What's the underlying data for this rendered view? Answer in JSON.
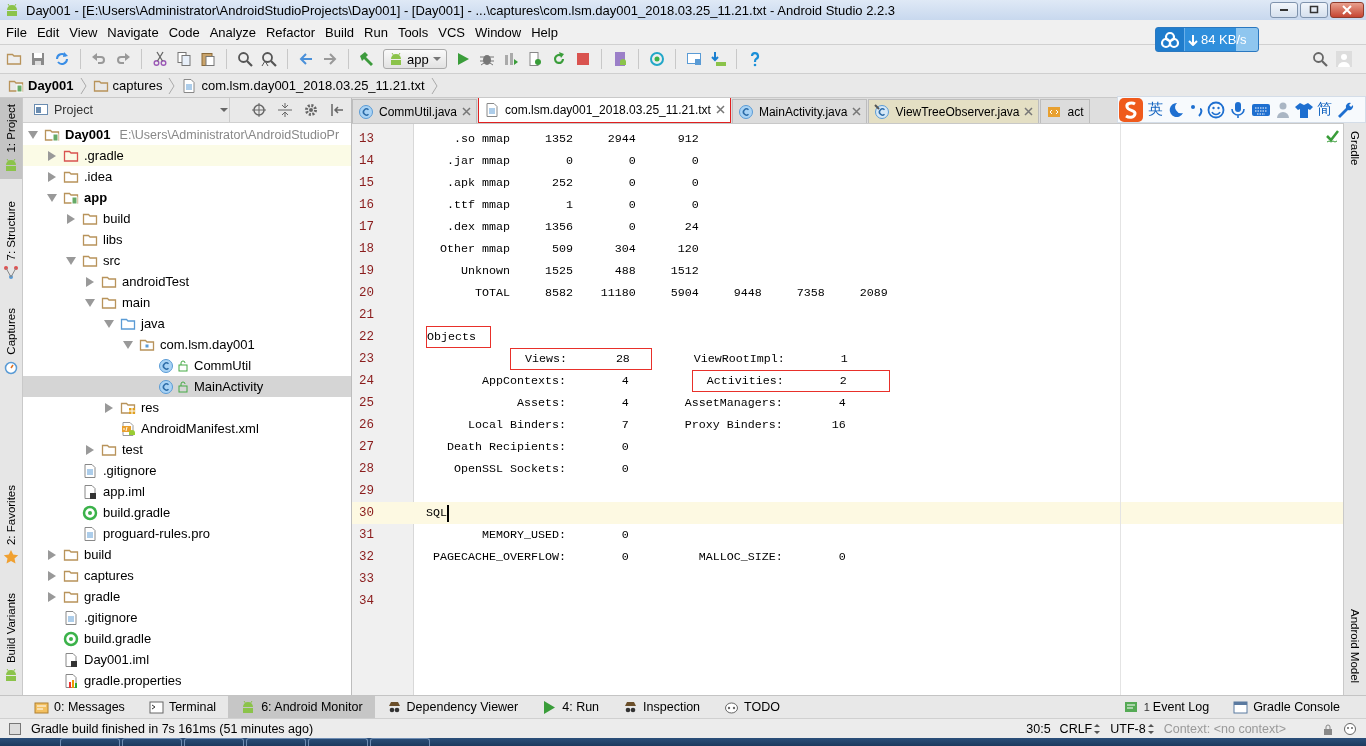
{
  "window": {
    "title": "Day001 - [E:\\Users\\Administrator\\AndroidStudioProjects\\Day001] - [Day001] - ...\\captures\\com.lsm.day001_2018.03.25_11.21.txt - Android Studio 2.2.3"
  },
  "menu": [
    "File",
    "Edit",
    "View",
    "Navigate",
    "Code",
    "Analyze",
    "Refactor",
    "Build",
    "Run",
    "Tools",
    "VCS",
    "Window",
    "Help"
  ],
  "toolbar": {
    "run_configuration": "app"
  },
  "breadcrumbs": [
    {
      "label": "Day001",
      "kind": "module"
    },
    {
      "label": "captures",
      "kind": "folder"
    },
    {
      "label": "com.lsm.day001_2018.03.25_11.21.txt",
      "kind": "text"
    }
  ],
  "left_strip": {
    "top": [
      {
        "label": "1: Project",
        "kind": "android",
        "selected": true
      },
      {
        "label": "7: Structure",
        "kind": "structure",
        "selected": false
      },
      {
        "label": "Captures",
        "kind": "camera",
        "selected": false
      }
    ],
    "bottom": [
      {
        "label": "2: Favorites",
        "kind": "star",
        "selected": false
      },
      {
        "label": "Build Variants",
        "kind": "android",
        "selected": false
      }
    ]
  },
  "right_strip": {
    "top": [
      {
        "label": "Gradle",
        "selected": false
      }
    ],
    "bottom": [
      {
        "label": "Android Model",
        "selected": false
      }
    ]
  },
  "project": {
    "view": "Project",
    "tree": [
      {
        "label": "Day001",
        "path": "E:\\Users\\Administrator\\AndroidStudioPr",
        "kind": "module",
        "expanded": true,
        "selected": false,
        "highlighted": false,
        "children": [
          {
            "label": ".gradle",
            "kind": "excluded-folder",
            "expanded": false,
            "selected": false,
            "highlighted": true
          },
          {
            "label": ".idea",
            "kind": "folder",
            "expanded": false,
            "selected": false,
            "highlighted": false
          },
          {
            "label": "app",
            "kind": "module",
            "expanded": true,
            "selected": false,
            "highlighted": false,
            "children": [
              {
                "label": "build",
                "kind": "folder",
                "expanded": false,
                "selected": false,
                "highlighted": false
              },
              {
                "label": "libs",
                "kind": "folder",
                "selected": false,
                "highlighted": false
              },
              {
                "label": "src",
                "kind": "folder",
                "expanded": true,
                "selected": false,
                "highlighted": false,
                "children": [
                  {
                    "label": "androidTest",
                    "kind": "folder",
                    "expanded": false,
                    "selected": false,
                    "highlighted": false
                  },
                  {
                    "label": "main",
                    "kind": "folder",
                    "expanded": true,
                    "selected": false,
                    "highlighted": false,
                    "children": [
                      {
                        "label": "java",
                        "kind": "source-folder",
                        "expanded": true,
                        "selected": false,
                        "highlighted": false,
                        "children": [
                          {
                            "label": "com.lsm.day001",
                            "kind": "package",
                            "expanded": true,
                            "selected": false,
                            "highlighted": false,
                            "children": [
                              {
                                "label": "CommUtil",
                                "kind": "class",
                                "selected": false,
                                "highlighted": false
                              },
                              {
                                "label": "MainActivity",
                                "kind": "class",
                                "selected": true,
                                "highlighted": false
                              }
                            ]
                          }
                        ]
                      },
                      {
                        "label": "res",
                        "kind": "resource-folder",
                        "expanded": false,
                        "selected": false,
                        "highlighted": false
                      },
                      {
                        "label": "AndroidManifest.xml",
                        "kind": "manifest",
                        "selected": false,
                        "highlighted": false
                      }
                    ]
                  },
                  {
                    "label": "test",
                    "kind": "folder",
                    "expanded": false,
                    "selected": false,
                    "highlighted": false
                  }
                ]
              },
              {
                "label": ".gitignore",
                "kind": "text",
                "selected": false,
                "highlighted": false
              },
              {
                "label": "app.iml",
                "kind": "iml",
                "selected": false,
                "highlighted": false
              },
              {
                "label": "build.gradle",
                "kind": "gradle",
                "selected": false,
                "highlighted": false
              },
              {
                "label": "proguard-rules.pro",
                "kind": "text",
                "selected": false,
                "highlighted": false
              }
            ]
          },
          {
            "label": "build",
            "kind": "folder",
            "expanded": false,
            "selected": false,
            "highlighted": false
          },
          {
            "label": "captures",
            "kind": "folder",
            "expanded": false,
            "selected": false,
            "highlighted": false
          },
          {
            "label": "gradle",
            "kind": "folder",
            "expanded": false,
            "selected": false,
            "highlighted": false
          },
          {
            "label": ".gitignore",
            "kind": "text",
            "selected": false,
            "highlighted": false
          },
          {
            "label": "build.gradle",
            "kind": "gradle",
            "selected": false,
            "highlighted": false
          },
          {
            "label": "Day001.iml",
            "kind": "iml",
            "selected": false,
            "highlighted": false
          },
          {
            "label": "gradle.properties",
            "kind": "properties",
            "selected": false,
            "highlighted": false
          }
        ]
      }
    ]
  },
  "editor": {
    "tabs": [
      {
        "label": "CommUtil.java",
        "kind": "class",
        "selected": false,
        "outlined": false
      },
      {
        "label": "com.lsm.day001_2018.03.25_11.21.txt",
        "kind": "text",
        "selected": true,
        "outlined": true
      },
      {
        "label": "MainActivity.java",
        "kind": "class",
        "selected": false,
        "outlined": false
      },
      {
        "label": "ViewTreeObserver.java",
        "kind": "library-class",
        "selected": false,
        "outlined": false
      },
      {
        "label": "act",
        "kind": "xml",
        "selected": false,
        "outlined": false
      }
    ],
    "lines": [
      {
        "number": "13",
        "text": "    .so mmap     1352     2944      912",
        "current": false
      },
      {
        "number": "14",
        "text": "   .jar mmap        0        0        0",
        "current": false
      },
      {
        "number": "15",
        "text": "   .apk mmap      252        0        0",
        "current": false
      },
      {
        "number": "16",
        "text": "   .ttf mmap        1        0        0",
        "current": false
      },
      {
        "number": "17",
        "text": "   .dex mmap     1356        0       24",
        "current": false
      },
      {
        "number": "18",
        "text": "  Other mmap      509      304      120",
        "current": false
      },
      {
        "number": "19",
        "text": "     Unknown     1525      488     1512",
        "current": false
      },
      {
        "number": "20",
        "text": "       TOTAL     8582    11180     5904     9448     7358     2089",
        "current": false
      },
      {
        "number": "21",
        "current": false
      },
      {
        "number": "22",
        "segments": [
          {
            "text": "Objects  ",
            "boxed": true
          }
        ],
        "current": false
      },
      {
        "number": "23",
        "segments": [
          {
            "text": "              Views:       28   ",
            "boxed": true
          },
          {
            "text": "      ViewRootImpl:        1",
            "boxed": false
          }
        ],
        "current": false
      },
      {
        "number": "24",
        "segments": [
          {
            "text": "        AppContexts:        4         ",
            "boxed": false
          },
          {
            "text": "  Activities:        2      ",
            "boxed": true
          }
        ],
        "current": false
      },
      {
        "number": "25",
        "text": "             Assets:        4        AssetManagers:        4",
        "current": false
      },
      {
        "number": "26",
        "text": "      Local Binders:        7        Proxy Binders:       16",
        "current": false
      },
      {
        "number": "27",
        "text": "   Death Recipients:        0",
        "current": false
      },
      {
        "number": "28",
        "text": "    OpenSSL Sockets:        0",
        "current": false
      },
      {
        "number": "29",
        "current": false
      },
      {
        "number": "30",
        "text": "SQL",
        "current": true
      },
      {
        "number": "31",
        "text": "        MEMORY_USED:        0",
        "current": false
      },
      {
        "number": "32",
        "text": " PAGECACHE_OVERFLOW:        0          MALLOC_SIZE:        0",
        "current": false
      },
      {
        "number": "33",
        "current": false
      },
      {
        "number": "34",
        "current": false
      }
    ]
  },
  "tool_windows": {
    "left": [
      {
        "label": "0: Messages",
        "kind": "messages",
        "selected": false
      },
      {
        "label": "Terminal",
        "kind": "terminal",
        "selected": false
      },
      {
        "label": "6: Android Monitor",
        "kind": "android",
        "selected": true
      },
      {
        "label": "Dependency Viewer",
        "kind": "spy",
        "selected": false
      },
      {
        "label": "4: Run",
        "kind": "run",
        "selected": false
      },
      {
        "label": "Inspection",
        "kind": "spy",
        "selected": false
      },
      {
        "label": "TODO",
        "kind": "todo",
        "selected": false
      }
    ],
    "right": [
      {
        "label": "Event Log",
        "badge": "1",
        "kind": "event-log",
        "selected": false
      },
      {
        "label": "Gradle Console",
        "kind": "console",
        "selected": false
      }
    ]
  },
  "status_bar": {
    "message": "Gradle build finished in 7s 161ms (51 minutes ago)",
    "position": "30:5",
    "line_separator": "CRLF",
    "encoding": "UTF-8",
    "context": "Context: <no context>"
  },
  "network_widget": {
    "speed": "84 KB/s"
  },
  "input_method_bar": {
    "language": "英",
    "script": "简"
  }
}
